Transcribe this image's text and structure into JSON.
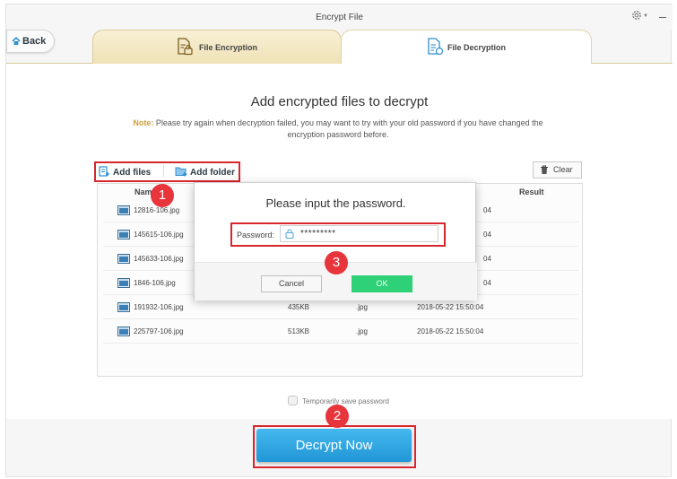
{
  "window": {
    "title": "Encrypt File"
  },
  "nav": {
    "back_label": "Back"
  },
  "tabs": [
    {
      "label": "File Encryption",
      "icon": "lock-document-icon"
    },
    {
      "label": "File Decryption",
      "icon": "document-list-icon",
      "active": true
    }
  ],
  "main": {
    "heading": "Add encrypted files to decrypt",
    "note_label": "Note:",
    "note_text": "Please try again when decryption failed, you may want to try with your old password if you have changed the encryption password before."
  },
  "toolbar": {
    "add_files": "Add files",
    "add_folder": "Add folder",
    "clear": "Clear"
  },
  "table": {
    "headers": {
      "name": "Name",
      "result": "Result"
    },
    "rows": [
      {
        "name": "12816-106.jpg",
        "date_suffix": "04"
      },
      {
        "name": "145615-106.jpg",
        "date_suffix": "04"
      },
      {
        "name": "145633-106.jpg",
        "date_suffix": "04"
      },
      {
        "name": "1846-106.jpg",
        "date_suffix": "04"
      },
      {
        "name": "191932-106.jpg",
        "size": "435KB",
        "type": ".jpg",
        "date": "2018-05-22 15:50:04"
      },
      {
        "name": "225797-106.jpg",
        "size": "513KB",
        "type": ".jpg",
        "date": "2018-05-22 15:50:04"
      }
    ]
  },
  "options": {
    "save_password": "Temporarily save password"
  },
  "actions": {
    "decrypt_now": "Decrypt Now"
  },
  "dialog": {
    "title": "Please input the password.",
    "password_label": "Password:",
    "password_value": "*********",
    "cancel": "Cancel",
    "ok": "OK"
  },
  "markers": [
    "1",
    "2",
    "3"
  ],
  "colors": {
    "accent": "#2196d6",
    "ok": "#2fd178",
    "highlight": "#d9252c",
    "tab_gold": "#efe2b6"
  }
}
